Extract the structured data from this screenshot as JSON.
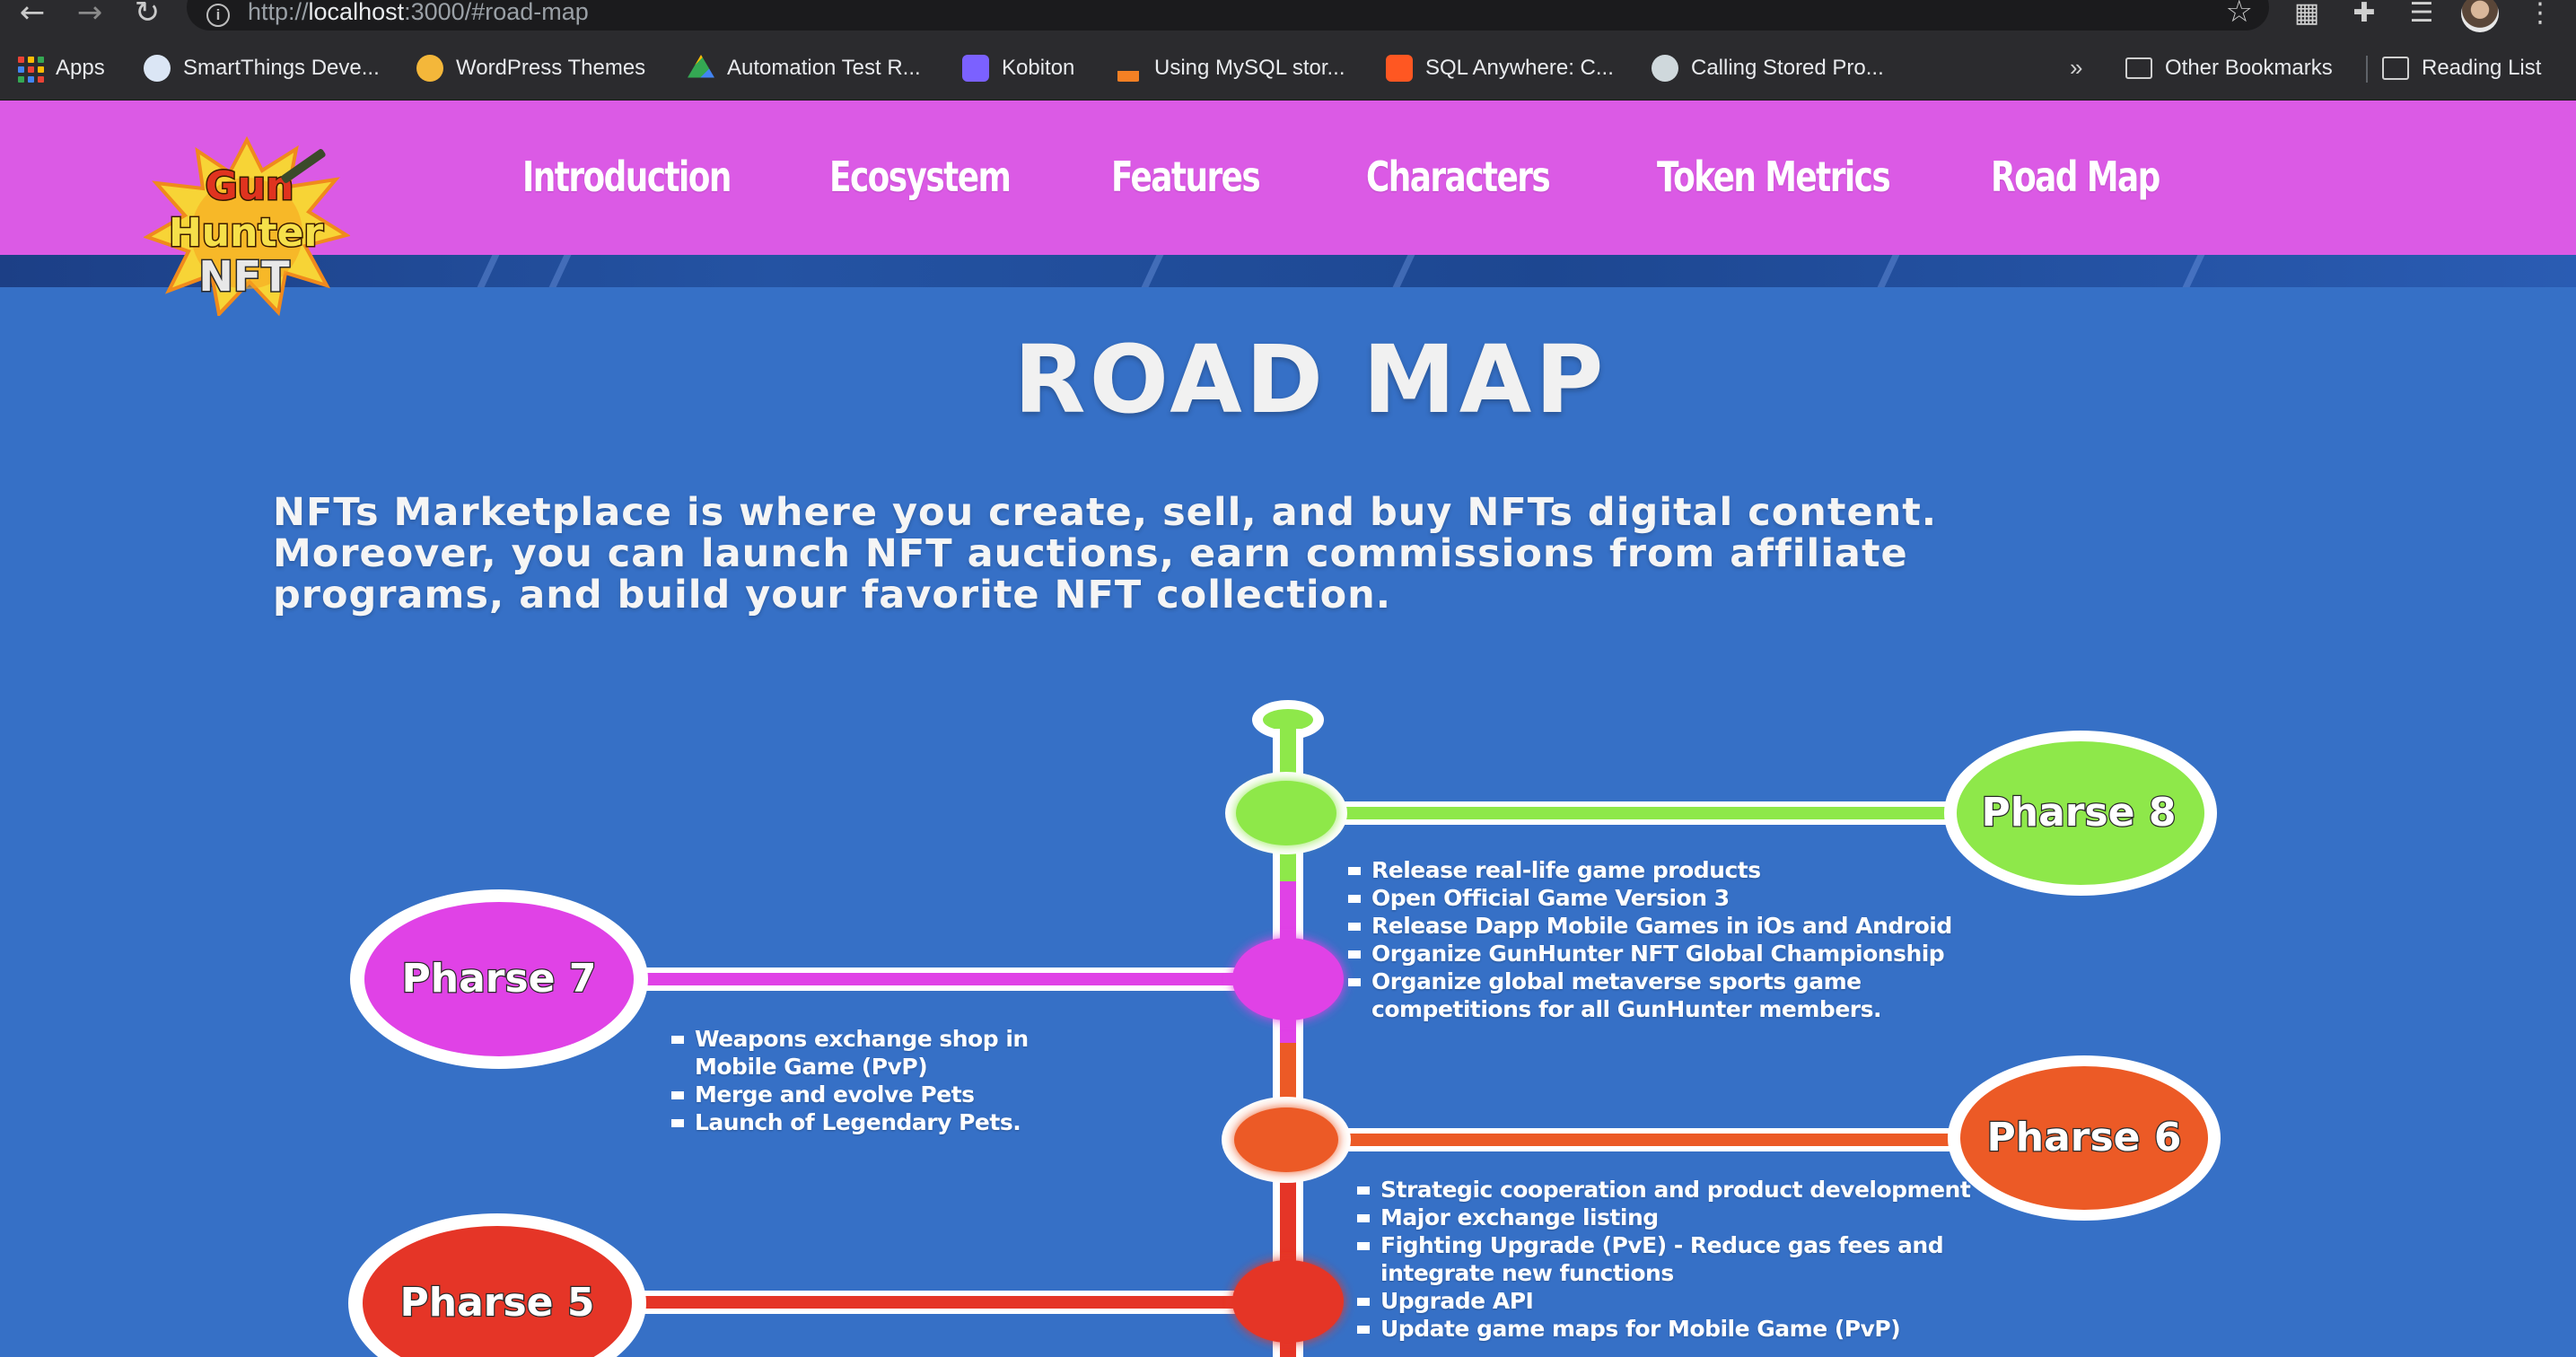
{
  "browser": {
    "url_scheme": "http://",
    "url_host": "localhost",
    "url_rest": ":3000/#road-map",
    "bookmarks": [
      {
        "label": "Apps",
        "icon": "apps-grid-icon"
      },
      {
        "label": "SmartThings Deve...",
        "icon": "smartthings-icon",
        "color": "#dbe6f5"
      },
      {
        "label": "WordPress Themes",
        "icon": "wordpress-themes-icon",
        "color": "#f4b73a"
      },
      {
        "label": "Automation Test R...",
        "icon": "google-drive-icon",
        "color": "#34a853"
      },
      {
        "label": "Kobiton",
        "icon": "kobiton-icon",
        "color": "#7b61ff"
      },
      {
        "label": "Using MySQL stor...",
        "icon": "stackoverflow-icon",
        "color": "#f48024"
      },
      {
        "label": "SQL Anywhere: C...",
        "icon": "blogger-icon",
        "color": "#ff5722"
      },
      {
        "label": "Calling Stored Pro...",
        "icon": "calling-icon",
        "color": "#cfd8dc"
      }
    ],
    "overflow_label": "»",
    "other_bookmarks": "Other Bookmarks",
    "reading_list": "Reading List"
  },
  "header": {
    "logo_text": [
      "Gun",
      "Hunter",
      "NFT"
    ],
    "nav": [
      "Introduction",
      "Ecosystem",
      "Features",
      "Characters",
      "Token Metrics",
      "Road Map"
    ]
  },
  "section": {
    "title": "ROAD MAP",
    "intro_lines": [
      "NFTs Marketplace is where you create, sell, and buy NFTs digital content.",
      "Moreover, you can launch NFT auctions, earn commissions from affiliate",
      "programs, and build your favorite NFT collection."
    ]
  },
  "roadmap": {
    "phases": [
      {
        "label": "Pharse 8",
        "color": "#8ee84a",
        "items": [
          "Release real-life game products",
          "Open Official Game Version 3",
          "Release Dapp Mobile Games in iOs and Android",
          "Organize GunHunter NFT Global Championship",
          "Organize global metaverse sports game competitions for all GunHunter members."
        ]
      },
      {
        "label": "Pharse 7",
        "color": "#e042e6",
        "items": [
          "Weapons exchange shop in Mobile Game (PvP)",
          "Merge and evolve Pets",
          "Launch of Legendary Pets."
        ]
      },
      {
        "label": "Pharse 6",
        "color": "#ec5a26",
        "items": [
          "Strategic cooperation and product development",
          "Major exchange listing",
          "Fighting Upgrade (PvE) - Reduce gas fees and integrate new functions",
          "Upgrade API",
          "Update game maps for Mobile Game (PvP)"
        ]
      },
      {
        "label": "Pharse 5",
        "color": "#e53527",
        "items": []
      }
    ]
  }
}
